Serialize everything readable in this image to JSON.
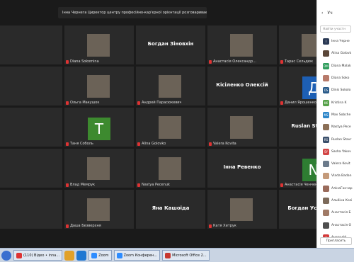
{
  "banner": {
    "text": "Інна Чернега Циректор центру професійно-кар'єрної орієнтації розговариває..."
  },
  "tiles": [
    {
      "name": "",
      "bigName": ""
    },
    {
      "name": "Diana Sokomina",
      "bigName": ""
    },
    {
      "name": "",
      "bigName": "Богдан Зіновхін"
    },
    {
      "name": "Анастасія Олександр...",
      "bigName": ""
    },
    {
      "name": "Тарас Сельдюк",
      "bigName": ""
    },
    {
      "name": "",
      "bigName": ""
    },
    {
      "name": "Ольга Макушок",
      "bigName": ""
    },
    {
      "name": "Андрей Парасюкевич",
      "bigName": ""
    },
    {
      "name": "",
      "bigName": "Кісіленко Олексій"
    },
    {
      "name": "Данил Ярошенко",
      "bigName": "",
      "letter": "Д",
      "letterColor": "#1d5fb4"
    },
    {
      "name": "",
      "bigName": ""
    },
    {
      "name": "Таня Соболь",
      "bigName": "",
      "letter": "T",
      "letterColor": "#3d8a2f"
    },
    {
      "name": "Alina Golovko",
      "bigName": ""
    },
    {
      "name": "Valera Kovita",
      "bigName": ""
    },
    {
      "name": "",
      "bigName": "Ruslan Stavratii"
    },
    {
      "name": "",
      "bigName": ""
    },
    {
      "name": "Влад Мемрук",
      "bigName": ""
    },
    {
      "name": "Nastya Pecenuk",
      "bigName": ""
    },
    {
      "name": "",
      "bigName": "Інна Ревенко"
    },
    {
      "name": "Анастасія Ченченко",
      "bigName": "",
      "letter": "N",
      "letterColor": "#2e7d32"
    },
    {
      "name": "",
      "bigName": ""
    },
    {
      "name": "Даша Безверхня",
      "bigName": ""
    },
    {
      "name": "",
      "bigName": "Яна Кашоіда"
    },
    {
      "name": "Катя Хитрук",
      "bigName": ""
    },
    {
      "name": "",
      "bigName": "Богдан Устимен..."
    }
  ],
  "panel": {
    "title": "Уч",
    "search_placeholder": "Найти участн",
    "invite": "Пригласить",
    "participants": [
      {
        "name": "Інна Черне",
        "initials": "I",
        "color": "#2b3a55"
      },
      {
        "name": "Alina Golovk",
        "initials": "",
        "color": "#5a4638"
      },
      {
        "name": "Diana Malak",
        "initials": "DM",
        "color": "#2e9c5b"
      },
      {
        "name": "Diana Soko",
        "initials": "",
        "color": "#b77a6a"
      },
      {
        "name": "Dinis Sokolo",
        "initials": "DS",
        "color": "#2a5b8a"
      },
      {
        "name": "Kristina K",
        "initials": "KK",
        "color": "#57a24a"
      },
      {
        "name": "Max Sobche",
        "initials": "MS",
        "color": "#2d86c9"
      },
      {
        "name": "Nastya Pece",
        "initials": "",
        "color": "#8b6f56"
      },
      {
        "name": "Ruslan Stavr",
        "initials": "RS",
        "color": "#3a4f6b"
      },
      {
        "name": "Sasha Yakov",
        "initials": "SY",
        "color": "#d24545"
      },
      {
        "name": "Valera Kovit",
        "initials": "",
        "color": "#6c7b8b"
      },
      {
        "name": "Vlada Badan",
        "initials": "",
        "color": "#c49a7a"
      },
      {
        "name": "АлінаГончар",
        "initials": "",
        "color": "#9a6b5b"
      },
      {
        "name": "Альбіна Козі",
        "initials": "",
        "color": "#7c6a5a"
      },
      {
        "name": "Анастасія Б",
        "initials": "",
        "color": "#a07a66"
      },
      {
        "name": "Анастасія О",
        "initials": "",
        "color": "#4f4f4f"
      },
      {
        "name": "Анатолій",
        "initials": "A",
        "color": "#d33a3a"
      }
    ]
  },
  "taskbar": {
    "items": [
      {
        "label": "(110) Відео • inna...",
        "color": "#d33"
      },
      {
        "label": "",
        "color": "#e1a12a"
      },
      {
        "label": "",
        "color": "#1f77d2"
      },
      {
        "label": "Zoom",
        "color": "#2d8cff"
      },
      {
        "label": "Zoom Конферен...",
        "color": "#2d8cff"
      },
      {
        "label": "Microsoft Office 2...",
        "color": "#c7372f"
      }
    ]
  }
}
